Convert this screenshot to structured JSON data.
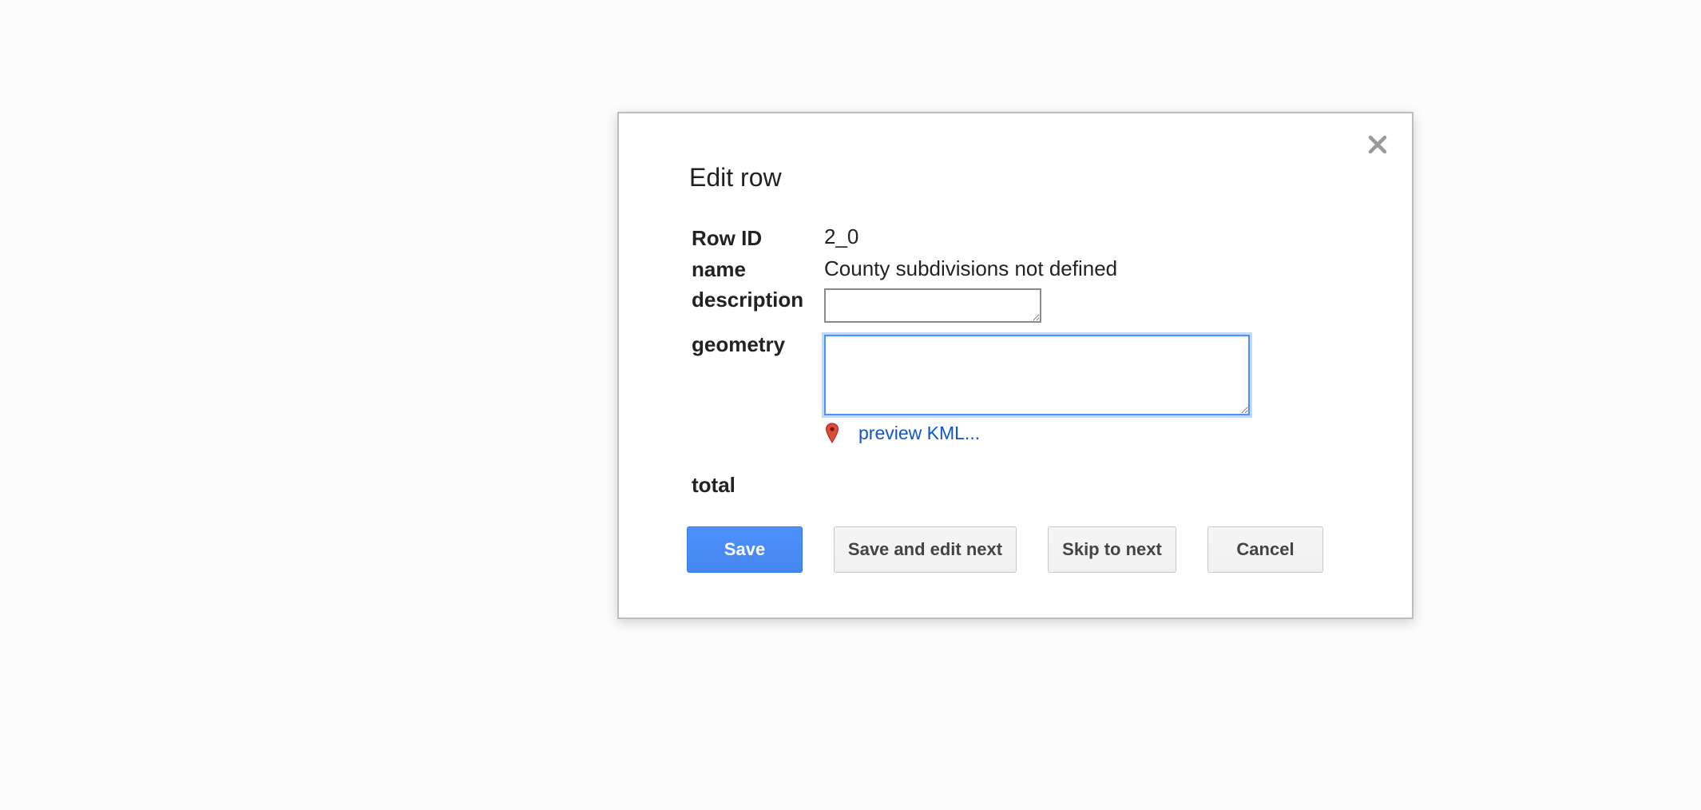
{
  "dialog": {
    "title": "Edit row",
    "close_icon": "close-icon",
    "fields": {
      "row_id": {
        "label": "Row ID",
        "value": "2_0"
      },
      "name": {
        "label": "name",
        "value": "County subdivisions not defined"
      },
      "description": {
        "label": "description",
        "value": ""
      },
      "geometry": {
        "label": "geometry",
        "value": ""
      },
      "total": {
        "label": "total"
      }
    },
    "kml": {
      "icon": "map-pin-icon",
      "link_label": "preview KML..."
    },
    "buttons": {
      "save": "Save",
      "save_edit_next": "Save and edit next",
      "skip_next": "Skip to next",
      "cancel": "Cancel"
    },
    "colors": {
      "primary": "#4d90fe",
      "link": "#1155cc",
      "pin": "#dd4b39"
    }
  }
}
